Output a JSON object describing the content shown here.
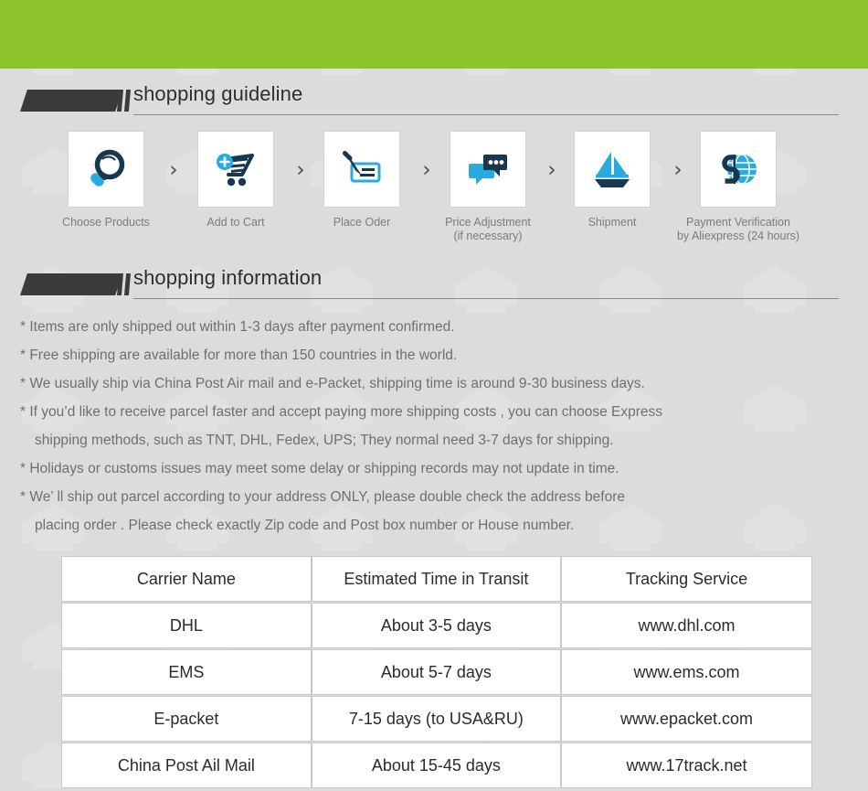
{
  "theme": {
    "banner_green": "#8cc22a",
    "page_background": "#dcdcdc",
    "icon_dark": "#18384f",
    "icon_accent": "#29abe2",
    "heading_dark": "#3b3b3b",
    "body_text": "#6f6f6f",
    "table_text": "#2b2b2b",
    "table_border": "#c9c9c9"
  },
  "sections": {
    "guideline": {
      "title": "shopping guideline"
    },
    "information": {
      "title": "shopping information"
    }
  },
  "steps": [
    {
      "icon": "magnifier-icon",
      "label_line1": "Choose Products",
      "label_line2": ""
    },
    {
      "icon": "add-to-cart-icon",
      "label_line1": "Add to Cart",
      "label_line2": ""
    },
    {
      "icon": "pen-check-icon",
      "label_line1": "Place Oder",
      "label_line2": ""
    },
    {
      "icon": "chat-bubbles-icon",
      "label_line1": "Price Adjustment",
      "label_line2": "(if necessary)"
    },
    {
      "icon": "sailboat-icon",
      "label_line1": "Shipment",
      "label_line2": ""
    },
    {
      "icon": "dollar-globe-icon",
      "label_line1": "Payment Verification",
      "label_line2": "by  Aliexpress (24 hours)"
    }
  ],
  "step_separator": "›",
  "info_lines": [
    {
      "text": "* Items are only shipped out within 1-3 days after payment confirmed.",
      "indent": false
    },
    {
      "text": "* Free shipping are available for more than 150 countries in the world.",
      "indent": false
    },
    {
      "text": "* We usually ship via China Post Air mail and e-Packet, shipping time is around 9-30 business days.",
      "indent": false
    },
    {
      "text": "* If you’d like to receive parcel faster and accept paying more shipping costs , you can choose Express",
      "indent": false
    },
    {
      "text": "shipping methods, such as TNT, DHL, Fedex, UPS; They normal need 3-7 days for shipping.",
      "indent": true
    },
    {
      "text": "* Holidays or customs issues may meet some delay or shipping records may not update in time.",
      "indent": false
    },
    {
      "text": "* We’ ll ship out parcel according to your address ONLY, please double check the address before",
      "indent": false
    },
    {
      "text": "placing order . Please check exactly Zip code and Post box number or House number.",
      "indent": true
    }
  ],
  "carrier_table": {
    "columns": [
      "Carrier Name",
      "Estimated Time in Transit",
      "Tracking Service"
    ],
    "rows": [
      [
        "DHL",
        "About 3-5 days",
        "www.dhl.com"
      ],
      [
        "EMS",
        "About 5-7 days",
        "www.ems.com"
      ],
      [
        "E-packet",
        "7-15 days (to USA&RU)",
        "www.epacket.com"
      ],
      [
        "China Post Ail Mail",
        "About 15-45 days",
        "www.17track.net"
      ]
    ]
  }
}
